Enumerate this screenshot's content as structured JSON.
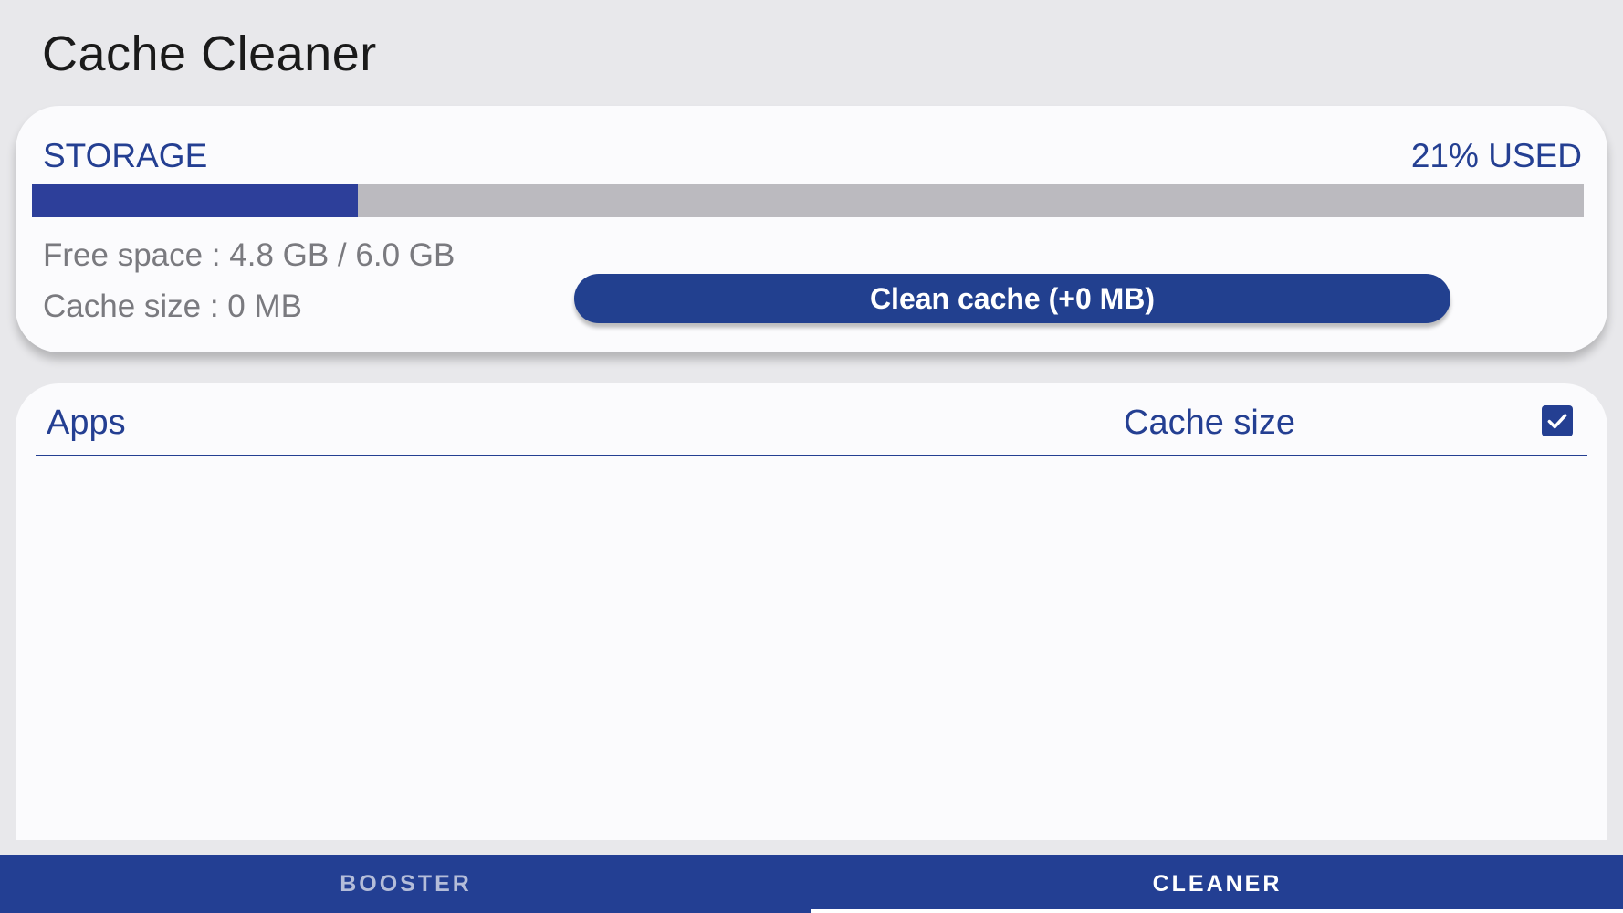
{
  "header": {
    "title": "Cache Cleaner"
  },
  "storage": {
    "label": "STORAGE",
    "used_text": "21% USED",
    "used_fraction": 0.21,
    "free_space": "Free space : 4.8 GB / 6.0 GB",
    "cache_size": "Cache size : 0 MB",
    "clean_button_label": "Clean cache (+0 MB)"
  },
  "apps_list": {
    "column_apps": "Apps",
    "column_cache": "Cache size",
    "select_all_checked": true,
    "items": []
  },
  "bottom_nav": {
    "tabs": [
      {
        "label": "BOOSTER",
        "active": false
      },
      {
        "label": "CLEANER",
        "active": true
      }
    ]
  },
  "colors": {
    "accent": "#243f92",
    "progress_track": "#bbbabf",
    "background": "#e8e8eb"
  }
}
